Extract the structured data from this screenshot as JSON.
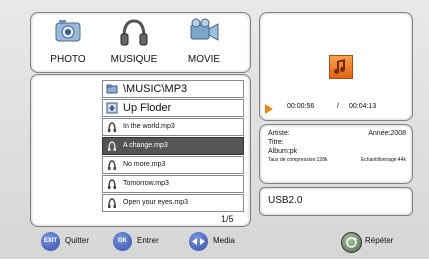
{
  "categories": [
    {
      "label": "PHOTO",
      "icon": "photo-icon"
    },
    {
      "label": "MUSIQUE",
      "icon": "headphones-icon"
    },
    {
      "label": "MOVIE",
      "icon": "movie-icon"
    }
  ],
  "file_list": {
    "path": "\\MUSIC\\MP3",
    "up_label": "Up Floder",
    "files": [
      "In the world.mp3",
      "A change.mp3",
      "No more.mp3",
      "Tomorrow.mp3",
      "Open your eyes.mp3"
    ],
    "selected_index": 1,
    "page": "1/5"
  },
  "player": {
    "elapsed": "00:00:56",
    "separator": "/",
    "total": "00:04:13"
  },
  "info": {
    "artist_label": "Artiste:",
    "year": "Année:2008",
    "title_label": "Titre:",
    "album_label": "Album:pk",
    "rate_label": "Taux de compression:128k",
    "sample_label": "Echantillonnage:44k"
  },
  "device": "USB2.0",
  "bottom": {
    "quit_key": "EXIT",
    "quit_label": "Quitter",
    "enter_key": "OK",
    "enter_label": "Entrer",
    "media_label": "Media",
    "repeat_label": "Répéter"
  },
  "colors": {
    "selected_row": "#555555",
    "remote_button": "#3a5bbf",
    "play_triangle": "#f0860f",
    "music_file": "#e8741b"
  }
}
